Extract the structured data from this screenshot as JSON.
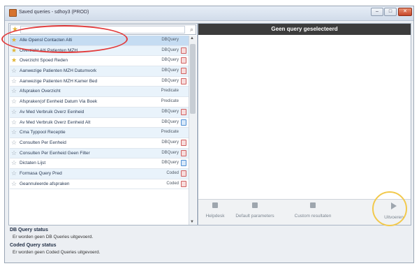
{
  "window": {
    "title": "Saved queries - sdhoy3 (PROD)",
    "min_glyph": "–",
    "max_glyph": "□",
    "close_glyph": "✕"
  },
  "search": {
    "value": "",
    "placeholder": "",
    "search_icon": "magnifier-icon",
    "star_icon": "star-icon"
  },
  "queries": [
    {
      "name": "Alle Opensl Contacten Alti",
      "type": "DBQuery",
      "favorite": true,
      "selected": true,
      "badge": ""
    },
    {
      "name": "Overzicht Alti Patienten MZH",
      "type": "DBQuery",
      "favorite": true,
      "selected": false,
      "badge": "red"
    },
    {
      "name": "Overzicht Spoed Reden",
      "type": "DBQuery",
      "favorite": true,
      "selected": false,
      "badge": "red"
    },
    {
      "name": "Aanwezige Patienten MZH Datumvork",
      "type": "DBQuery",
      "favorite": false,
      "selected": false,
      "badge": "red"
    },
    {
      "name": "Aanwezige Patienten MZH Kamer Bed",
      "type": "DBQuery",
      "favorite": false,
      "selected": false,
      "badge": "red"
    },
    {
      "name": "Afspraken Overzicht",
      "type": "Predicate",
      "favorite": false,
      "selected": false,
      "badge": ""
    },
    {
      "name": "Afspraken(of Eenheid Datum Via Boek",
      "type": "Predicate",
      "favorite": false,
      "selected": false,
      "badge": ""
    },
    {
      "name": "Av Med Verbruik Overz Eenheid",
      "type": "DBQuery",
      "favorite": false,
      "selected": false,
      "badge": "red"
    },
    {
      "name": "Av Med Verbruik Overz Eenheid Alt",
      "type": "DBQuery",
      "favorite": false,
      "selected": false,
      "badge": "blue"
    },
    {
      "name": "Cma Typpool Receptie",
      "type": "Predicate",
      "favorite": false,
      "selected": false,
      "badge": ""
    },
    {
      "name": "Consulten Per Eenheid",
      "type": "DBQuery",
      "favorite": false,
      "selected": false,
      "badge": "red"
    },
    {
      "name": "Consulten Per Eenheid Geen Filter",
      "type": "DBQuery",
      "favorite": false,
      "selected": false,
      "badge": "red"
    },
    {
      "name": "Dictaten Lijst",
      "type": "DBQuery",
      "favorite": false,
      "selected": false,
      "badge": "blue"
    },
    {
      "name": "Formasa Query Pred",
      "type": "Coded",
      "favorite": false,
      "selected": false,
      "badge": "red"
    },
    {
      "name": "Geannuleerde afspraken",
      "type": "Coded",
      "favorite": false,
      "selected": false,
      "badge": "red"
    }
  ],
  "right_panel": {
    "header": "Geen query geselecteerd"
  },
  "toolbar": {
    "helpdesk": "Helpdesk",
    "default_parameters": "Default parameters",
    "custom_resultaten": "Custom resultaten",
    "uitvoeren": "Uitvoeren"
  },
  "status": {
    "db_heading": "DB Query status",
    "db_text": "Er worden geen DB Queries uitgevoerd.",
    "coded_heading": "Coded Query status",
    "coded_text": "Er worden geen Coded Queries uitgevoerd."
  },
  "colors": {
    "annotation_red": "#e23b3b",
    "annotation_yellow": "#f2c94c",
    "header_dark": "#3c3c3c"
  }
}
